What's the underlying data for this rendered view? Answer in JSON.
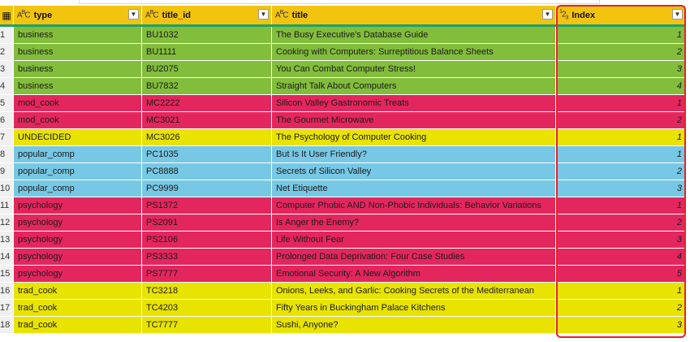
{
  "header": {
    "row_selector": "▦",
    "columns": [
      {
        "type_icon": "ABC",
        "label": "type"
      },
      {
        "type_icon": "ABC",
        "label": "title_id"
      },
      {
        "type_icon": "ABC",
        "label": "title"
      },
      {
        "type_icon": "123",
        "label": "Index"
      }
    ],
    "dropdown_glyph": "▼"
  },
  "colors": {
    "business": "#82bd3c",
    "mod_cook": "#e4265e",
    "UNDECIDED": "#e8e300",
    "popular_comp": "#77c8e4",
    "psychology": "#e4265e",
    "trad_cook": "#e8e300",
    "header": "#f2c40f",
    "highlight_box": "#e8202a"
  },
  "rows": [
    {
      "num": "1",
      "type": "business",
      "title_id": "BU1032",
      "title": "The Busy Executive's Database Guide",
      "index": "1"
    },
    {
      "num": "2",
      "type": "business",
      "title_id": "BU1111",
      "title": "Cooking with Computers: Surreptitious Balance Sheets",
      "index": "2"
    },
    {
      "num": "3",
      "type": "business",
      "title_id": "BU2075",
      "title": "You Can Combat Computer Stress!",
      "index": "3"
    },
    {
      "num": "4",
      "type": "business",
      "title_id": "BU7832",
      "title": "Straight Talk About Computers",
      "index": "4"
    },
    {
      "num": "5",
      "type": "mod_cook",
      "title_id": "MC2222",
      "title": "Silicon Valley Gastronomic Treats",
      "index": "1"
    },
    {
      "num": "6",
      "type": "mod_cook",
      "title_id": "MC3021",
      "title": "The Gourmet Microwave",
      "index": "2"
    },
    {
      "num": "7",
      "type": "UNDECIDED",
      "title_id": "MC3026",
      "title": "The Psychology of Computer Cooking",
      "index": "1"
    },
    {
      "num": "8",
      "type": "popular_comp",
      "title_id": "PC1035",
      "title": "But Is It User Friendly?",
      "index": "1"
    },
    {
      "num": "9",
      "type": "popular_comp",
      "title_id": "PC8888",
      "title": "Secrets of Silicon Valley",
      "index": "2"
    },
    {
      "num": "10",
      "type": "popular_comp",
      "title_id": "PC9999",
      "title": "Net Etiquette",
      "index": "3"
    },
    {
      "num": "11",
      "type": "psychology",
      "title_id": "PS1372",
      "title": "Computer Phobic AND Non-Phobic Individuals: Behavior Variations",
      "index": "1"
    },
    {
      "num": "12",
      "type": "psychology",
      "title_id": "PS2091",
      "title": "Is Anger the Enemy?",
      "index": "2"
    },
    {
      "num": "13",
      "type": "psychology",
      "title_id": "PS2106",
      "title": "Life Without Fear",
      "index": "3"
    },
    {
      "num": "14",
      "type": "psychology",
      "title_id": "PS3333",
      "title": "Prolonged Data Deprivation: Four Case Studies",
      "index": "4"
    },
    {
      "num": "15",
      "type": "psychology",
      "title_id": "PS7777",
      "title": "Emotional Security: A New Algorithm",
      "index": "5"
    },
    {
      "num": "16",
      "type": "trad_cook",
      "title_id": "TC3218",
      "title": "Onions, Leeks, and Garlic: Cooking Secrets of the Mediterranean",
      "index": "1"
    },
    {
      "num": "17",
      "type": "trad_cook",
      "title_id": "TC4203",
      "title": "Fifty Years in Buckingham Palace Kitchens",
      "index": "2"
    },
    {
      "num": "18",
      "type": "trad_cook",
      "title_id": "TC7777",
      "title": "Sushi, Anyone?",
      "index": "3"
    }
  ]
}
